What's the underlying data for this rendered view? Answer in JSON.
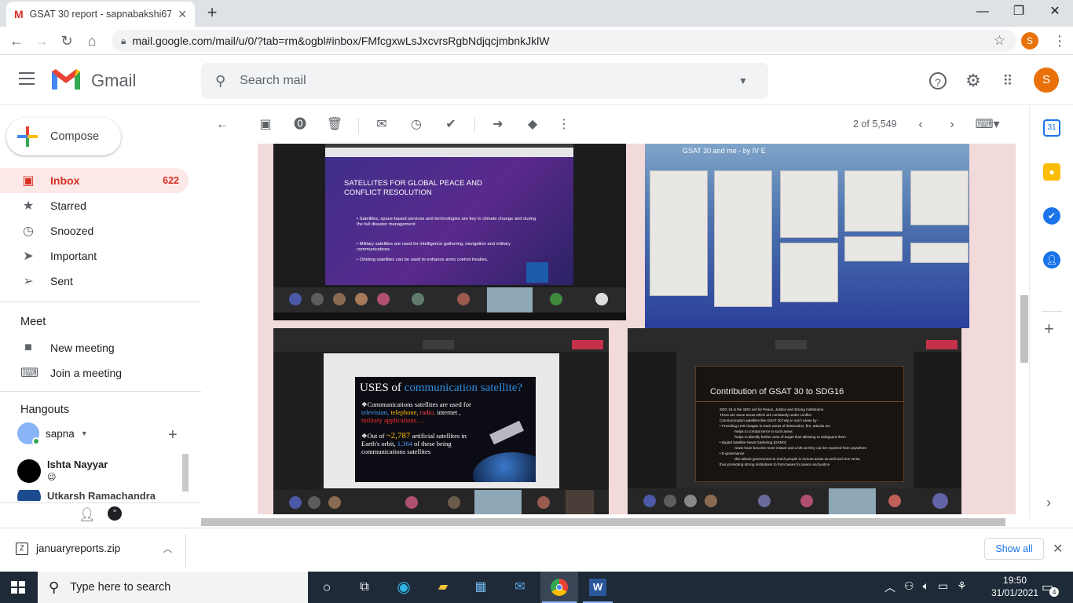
{
  "browser": {
    "tab_title": "GSAT 30 report - sapnabakshi670",
    "url": "mail.google.com/mail/u/0/?tab=rm&ogbl#inbox/FMfcgxwLsJxcvrsRgbNdjqcjmbnkJklW",
    "profile_initial": "S"
  },
  "gmail": {
    "product_name": "Gmail",
    "search_placeholder": "Search mail",
    "avatar_initial": "S",
    "compose_label": "Compose",
    "nav": [
      {
        "label": "Inbox",
        "count": "622",
        "icon": "inbox-icon"
      },
      {
        "label": "Starred",
        "count": "",
        "icon": "star-icon"
      },
      {
        "label": "Snoozed",
        "count": "",
        "icon": "clock-icon"
      },
      {
        "label": "Important",
        "count": "",
        "icon": "important-icon"
      },
      {
        "label": "Sent",
        "count": "",
        "icon": "send-icon"
      }
    ],
    "meet": {
      "title": "Meet",
      "new_meeting": "New meeting",
      "join_meeting": "Join a meeting"
    },
    "hangouts": {
      "title": "Hangouts",
      "self_name": "sapna",
      "contacts": [
        {
          "name": "Ishta Nayyar",
          "status": "😉"
        },
        {
          "name": "Utkarsh Ramachandra",
          "status": ""
        }
      ]
    },
    "pager": "2 of 5,549",
    "rail_calendar_day": "31"
  },
  "email_images": {
    "slide1": {
      "title": "SATELLITES FOR GLOBAL PEACE AND CONFLICT RESOLUTION",
      "bullets": [
        "Satellites, space-based services and technologies are key in climate change and during the full disaster management",
        "Military satellites are used for intelligence gathering, navigation and military communications.",
        "Orbiting satellites can be used to enhance arms control treaties."
      ]
    },
    "slide2": {
      "title": "GSAT 30 and me - by IV E"
    },
    "slide3": {
      "title_prefix": "USES of",
      "title_highlight": "communication satellite?",
      "bullet1_lead": "Communications satellites are used for",
      "bullet1_items": [
        "television,",
        "telephone,",
        "radio,",
        "internet ,"
      ],
      "bullet1_tail": "military applications….",
      "bullet2_a": "Out of",
      "bullet2_num1": "~2,787",
      "bullet2_b": "artificial satellites in Earth's orbit,",
      "bullet2_num2": "1,364",
      "bullet2_c": "of these being communications satellites"
    },
    "slide4": {
      "title": "Contribution of GSAT 30 to SDG16",
      "lines": [
        "SDG 16 is the SDG set for Peace, Justice and Strong Institutions.",
        "There are some areas which are constantly under conflict.",
        "Communication satellites like GSAT 30 help in such areas by -",
        "• Providing LIVE images to track areas of destruction, fire, attacks etc.",
        "-helps to combat terror in such areas",
        "-helps to identify further area of target thus allowing to safeguard them",
        "• Digital Satellite News Gathering (DSNG)",
        "-news have become more instant and LIVE as they can be reported from anywhere",
        "• E-governance",
        "-this allows government to reach people in remote areas as well and vice versa",
        "thus promoting strong institutions to form bases for peace and justice"
      ]
    }
  },
  "download": {
    "filename": "januaryreports.zip",
    "show_all": "Show all"
  },
  "taskbar": {
    "search_placeholder": "Type here to search",
    "time": "19:50",
    "date": "31/01/2021",
    "notifications": "4"
  },
  "colors": {
    "gmail_red": "#d93025",
    "inbox_bg": "#fce8e6",
    "accent_blue": "#1a73e8",
    "email_bg_pink": "#f2d9da",
    "avatar_orange": "#e8710a"
  }
}
